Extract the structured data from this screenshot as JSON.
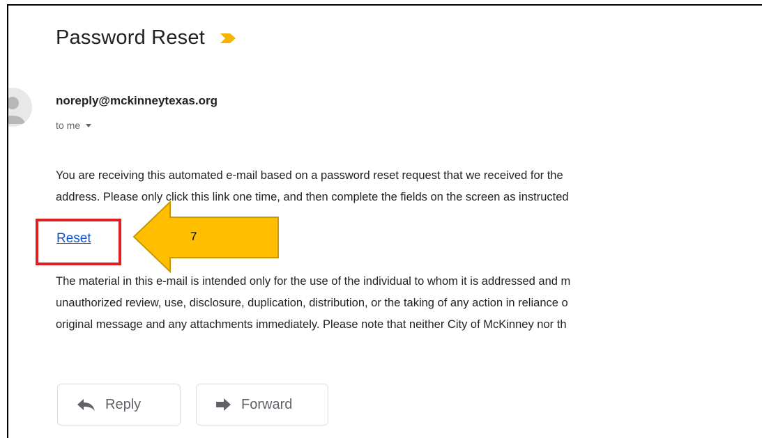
{
  "email": {
    "subject": "Password Reset",
    "sender": "noreply@mckinneytexas.org",
    "recipient": "to me",
    "body_line_1": "You are receiving this automated e-mail based on a password reset request that we received for the",
    "body_line_2": "address. Please only click this link one time, and then complete the fields on the screen as instructed",
    "link_label": "Reset",
    "disclaimer_line_1": "The material in this e-mail is intended only for the use of the individual to whom it is addressed and m",
    "disclaimer_line_2": "unauthorized review, use, disclosure, duplication, distribution, or the taking of any action in reliance o",
    "disclaimer_line_3": "original message and any attachments immediately. Please note that neither City of McKinney nor th"
  },
  "actions": {
    "reply_label": "Reply",
    "forward_label": "Forward"
  },
  "annotation": {
    "step_number": "7",
    "arrow_color": "#ffbf00",
    "box_color": "#e02020"
  },
  "icons": {
    "importance": "importance-marker-icon",
    "avatar": "person-avatar-icon",
    "caret": "caret-down-icon",
    "reply": "reply-arrow-icon",
    "forward": "forward-arrow-icon"
  }
}
